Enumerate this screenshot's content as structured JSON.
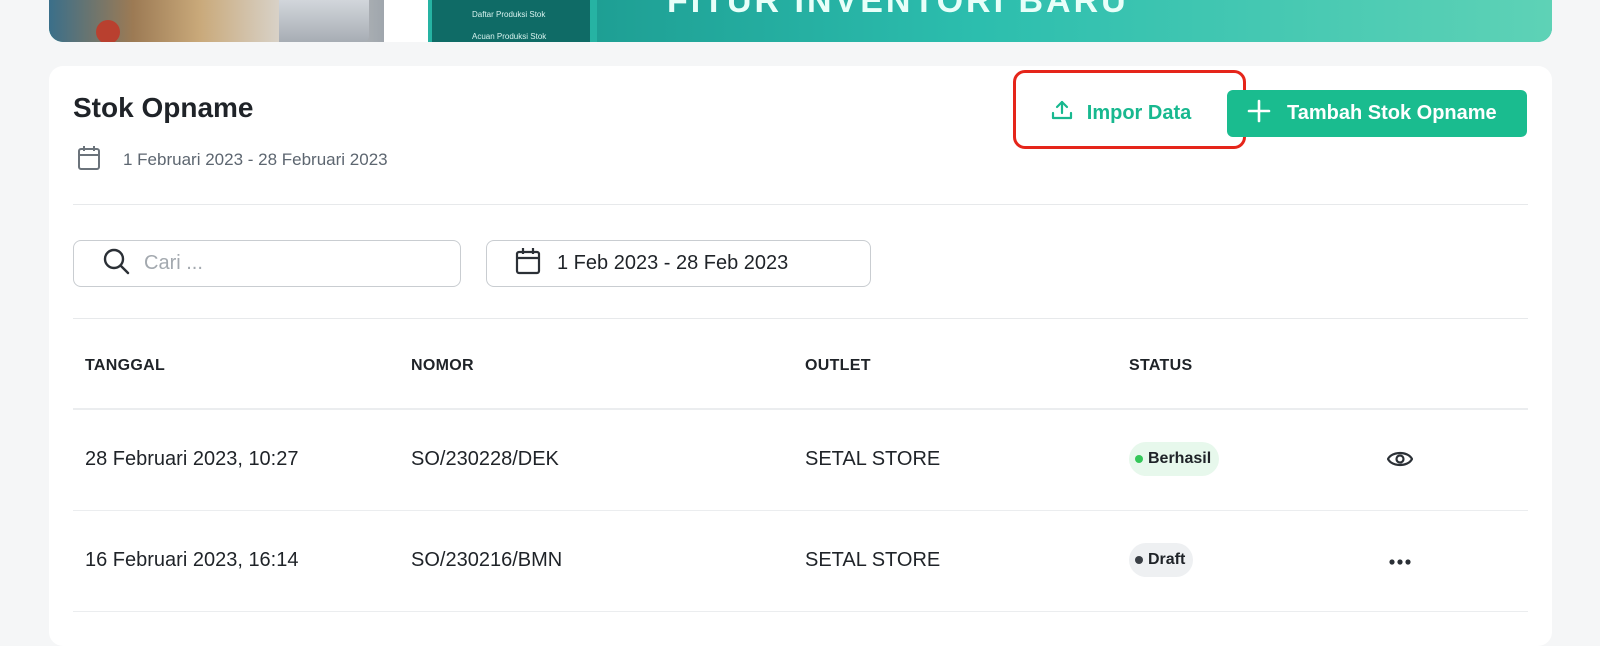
{
  "banner": {
    "menu_items": [
      "Daftar Produksi Stok",
      "Acuan Produksi Stok"
    ],
    "headline": "FITUR INVENTORI BARU"
  },
  "page": {
    "title": "Stok Opname",
    "period": "1 Februari 2023 - 28 Februari 2023"
  },
  "toolbar": {
    "import_label": "Impor Data",
    "add_label": "Tambah Stok Opname"
  },
  "filters": {
    "search_placeholder": "Cari ...",
    "date_range": "1 Feb 2023 - 28 Feb 2023"
  },
  "table": {
    "headers": [
      "TANGGAL",
      "NOMOR",
      "OUTLET",
      "STATUS"
    ],
    "rows": [
      {
        "tanggal": "28 Februari 2023, 10:27",
        "nomor": "SO/230228/DEK",
        "outlet": "SETAL STORE",
        "status": "Berhasil",
        "action_icon": "eye-icon"
      },
      {
        "tanggal": "16 Februari 2023, 16:14",
        "nomor": "SO/230216/BMN",
        "outlet": "SETAL STORE",
        "status": "Draft",
        "action_icon": "more-horizontal-icon"
      }
    ]
  },
  "colors": {
    "accent": "#1abc8f",
    "highlight": "#e5251a",
    "success_badge": "#e7f8ec",
    "draft_badge": "#eef0f2"
  }
}
